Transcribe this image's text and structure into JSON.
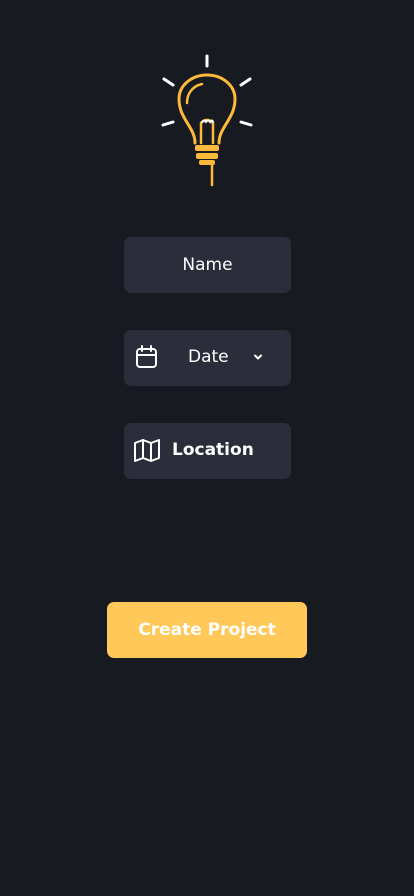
{
  "colors": {
    "background": "#171a21",
    "field_background": "#2b2e3a",
    "accent": "#ffc859",
    "bulb": "#fdb93a",
    "text": "#ffffff"
  },
  "form": {
    "name_placeholder": "Name",
    "date": {
      "label": "Date",
      "icon": "calendar-icon",
      "dropdown_icon": "chevron-down-icon"
    },
    "location": {
      "label": "Location",
      "icon": "map-icon"
    },
    "submit_label": "Create Project"
  },
  "logo": {
    "icon": "lightbulb-icon"
  }
}
